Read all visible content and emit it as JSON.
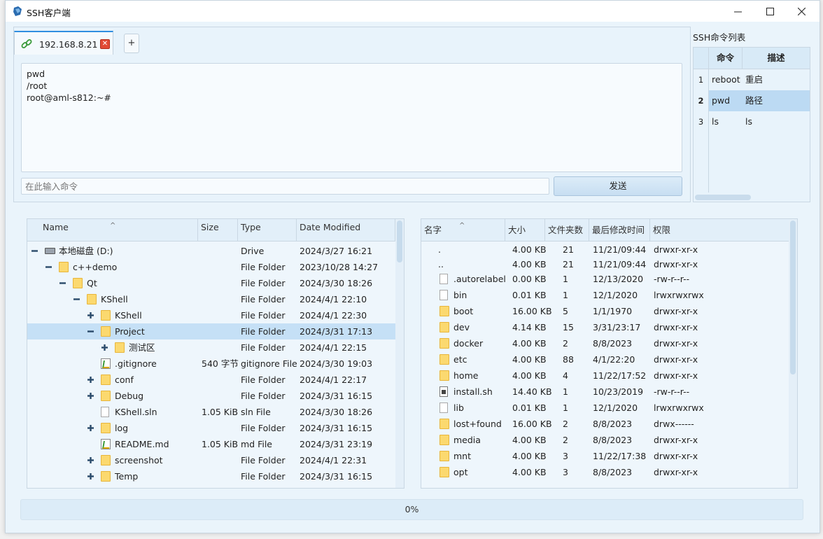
{
  "window": {
    "title": "SSH客户端"
  },
  "tabs": [
    {
      "label": "192.168.8.21",
      "close": "✕"
    }
  ],
  "tab_add_label": "+",
  "terminal": {
    "lines": [
      "pwd",
      "/root",
      "root@aml-s812:~#"
    ]
  },
  "input": {
    "placeholder": "在此输入命令"
  },
  "send_label": "发送",
  "command_list": {
    "title": "SSH命令列表",
    "headers": [
      "命令",
      "描述"
    ],
    "rows": [
      {
        "n": "1",
        "cmd": "reboot",
        "desc": "重启"
      },
      {
        "n": "2",
        "cmd": "pwd",
        "desc": "路径"
      },
      {
        "n": "3",
        "cmd": "ls",
        "desc": "ls"
      }
    ],
    "selected": 2
  },
  "local_tree": {
    "headers": [
      "Name",
      "Size",
      "Type",
      "Date Modified"
    ],
    "rows": [
      {
        "name": "本地磁盘 (D:)",
        "size": "",
        "type": "Drive",
        "date": "2024/3/27 16:21"
      },
      {
        "name": "c++demo",
        "size": "",
        "type": "File Folder",
        "date": "2023/10/28 14:27"
      },
      {
        "name": "Qt",
        "size": "",
        "type": "File Folder",
        "date": "2024/3/30 18:26"
      },
      {
        "name": "KShell",
        "size": "",
        "type": "File Folder",
        "date": "2024/4/1 22:10"
      },
      {
        "name": "KShell",
        "size": "",
        "type": "File Folder",
        "date": "2024/4/1 22:30"
      },
      {
        "name": "Project",
        "size": "",
        "type": "File Folder",
        "date": "2024/3/31 17:13"
      },
      {
        "name": "测试区",
        "size": "",
        "type": "File Folder",
        "date": "2024/4/1 22:15"
      },
      {
        "name": ".gitignore",
        "size": "540 字节",
        "type": "gitignore File",
        "date": "2024/3/30 19:03"
      },
      {
        "name": "conf",
        "size": "",
        "type": "File Folder",
        "date": "2024/4/1 22:17"
      },
      {
        "name": "Debug",
        "size": "",
        "type": "File Folder",
        "date": "2024/3/31 16:15"
      },
      {
        "name": "KShell.sln",
        "size": "1.05 KiB",
        "type": "sln File",
        "date": "2024/3/30 18:26"
      },
      {
        "name": "log",
        "size": "",
        "type": "File Folder",
        "date": "2024/3/31 16:15"
      },
      {
        "name": "README.md",
        "size": "1.05 KiB",
        "type": "md File",
        "date": "2024/3/31 23:19"
      },
      {
        "name": "screenshot",
        "size": "",
        "type": "File Folder",
        "date": "2024/4/1 22:31"
      },
      {
        "name": "Temp",
        "size": "",
        "type": "File Folder",
        "date": "2024/3/31 16:15"
      }
    ]
  },
  "remote_list": {
    "headers": [
      "名字",
      "大小",
      "文件夹数",
      "最后修改时间",
      "权限"
    ],
    "rows": [
      {
        "name": ".",
        "size": "4.00 KB",
        "count": "21",
        "time": "11/21/09:44",
        "perm": "drwxr-xr-x"
      },
      {
        "name": "..",
        "size": "4.00 KB",
        "count": "21",
        "time": "11/21/09:44",
        "perm": "drwxr-xr-x"
      },
      {
        "name": ".autorelabel",
        "size": "0.00 KB",
        "count": "1",
        "time": "12/13/2020",
        "perm": "-rw-r--r--"
      },
      {
        "name": "bin",
        "size": "0.01 KB",
        "count": "1",
        "time": "12/1/2020",
        "perm": "lrwxrwxrwx"
      },
      {
        "name": "boot",
        "size": "16.00 KB",
        "count": "5",
        "time": "1/1/1970",
        "perm": "drwxr-xr-x"
      },
      {
        "name": "dev",
        "size": "4.14 KB",
        "count": "15",
        "time": "3/31/23:17",
        "perm": "drwxr-xr-x"
      },
      {
        "name": "docker",
        "size": "4.00 KB",
        "count": "2",
        "time": "8/8/2023",
        "perm": "drwxr-xr-x"
      },
      {
        "name": "etc",
        "size": "4.00 KB",
        "count": "88",
        "time": "4/1/22:20",
        "perm": "drwxr-xr-x"
      },
      {
        "name": "home",
        "size": "4.00 KB",
        "count": "4",
        "time": "11/22/17:52",
        "perm": "drwxr-xr-x"
      },
      {
        "name": "install.sh",
        "size": "14.40 KB",
        "count": "1",
        "time": "10/23/2019",
        "perm": "-rw-r--r--"
      },
      {
        "name": "lib",
        "size": "0.01 KB",
        "count": "1",
        "time": "12/1/2020",
        "perm": "lrwxrwxrwx"
      },
      {
        "name": "lost+found",
        "size": "16.00 KB",
        "count": "2",
        "time": "8/8/2023",
        "perm": "drwx------"
      },
      {
        "name": "media",
        "size": "4.00 KB",
        "count": "2",
        "time": "8/8/2023",
        "perm": "drwxr-xr-x"
      },
      {
        "name": "mnt",
        "size": "4.00 KB",
        "count": "3",
        "time": "11/22/17:38",
        "perm": "drwxr-xr-x"
      },
      {
        "name": "opt",
        "size": "4.00 KB",
        "count": "3",
        "time": "8/8/2023",
        "perm": "drwxr-xr-x"
      }
    ]
  },
  "progress": {
    "label": "0%",
    "value": 0
  }
}
